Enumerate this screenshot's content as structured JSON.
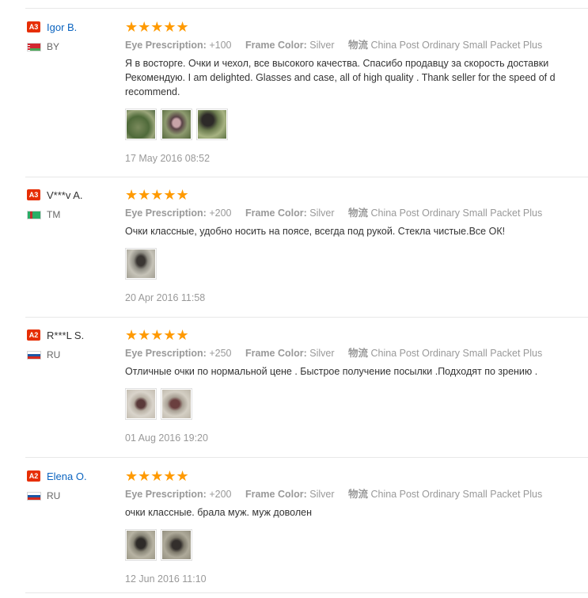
{
  "labels": {
    "prescription": "Eye Prescription:",
    "frame": "Frame Color:",
    "logistics": "物流"
  },
  "stars": "★★★★★",
  "reviews": [
    {
      "level": "A3",
      "name": "Igor B.",
      "name_is_link": true,
      "country": "BY",
      "prescription": "+100",
      "frame": "Silver",
      "logistics": "China Post Ordinary Small Packet Plus",
      "text_lines": [
        "Я в восторге. Очки и чехол, все высокого качества. Спасибо продавцу за скорость доставки",
        "Рекомендую. I am delighted. Glasses and case, all of high quality . Thank seller for the speed of d",
        "recommend."
      ],
      "photo_count": 3,
      "date": "17 May 2016 08:52"
    },
    {
      "level": "A3",
      "name": "V***v A.",
      "name_is_link": false,
      "country": "TM",
      "prescription": "+200",
      "frame": "Silver",
      "logistics": "China Post Ordinary Small Packet Plus",
      "text_lines": [
        "Очки классные, удобно носить на поясе, всегда под рукой. Стекла чистые.Все ОК!"
      ],
      "photo_count": 1,
      "date": "20 Apr 2016 11:58"
    },
    {
      "level": "A2",
      "name": "R***L S.",
      "name_is_link": false,
      "country": "RU",
      "prescription": "+250",
      "frame": "Silver",
      "logistics": "China Post Ordinary Small Packet Plus",
      "text_lines": [
        "Отличные очки по нормальной цене . Быстрое получение посылки .Подходят по зрению ."
      ],
      "photo_count": 2,
      "date": "01 Aug 2016 19:20"
    },
    {
      "level": "A2",
      "name": "Elena O.",
      "name_is_link": true,
      "country": "RU",
      "prescription": "+200",
      "frame": "Silver",
      "logistics": "China Post Ordinary Small Packet Plus",
      "text_lines": [
        "очки классные. брала муж. муж доволен"
      ],
      "photo_count": 2,
      "date": "12 Jun 2016 11:10"
    }
  ]
}
